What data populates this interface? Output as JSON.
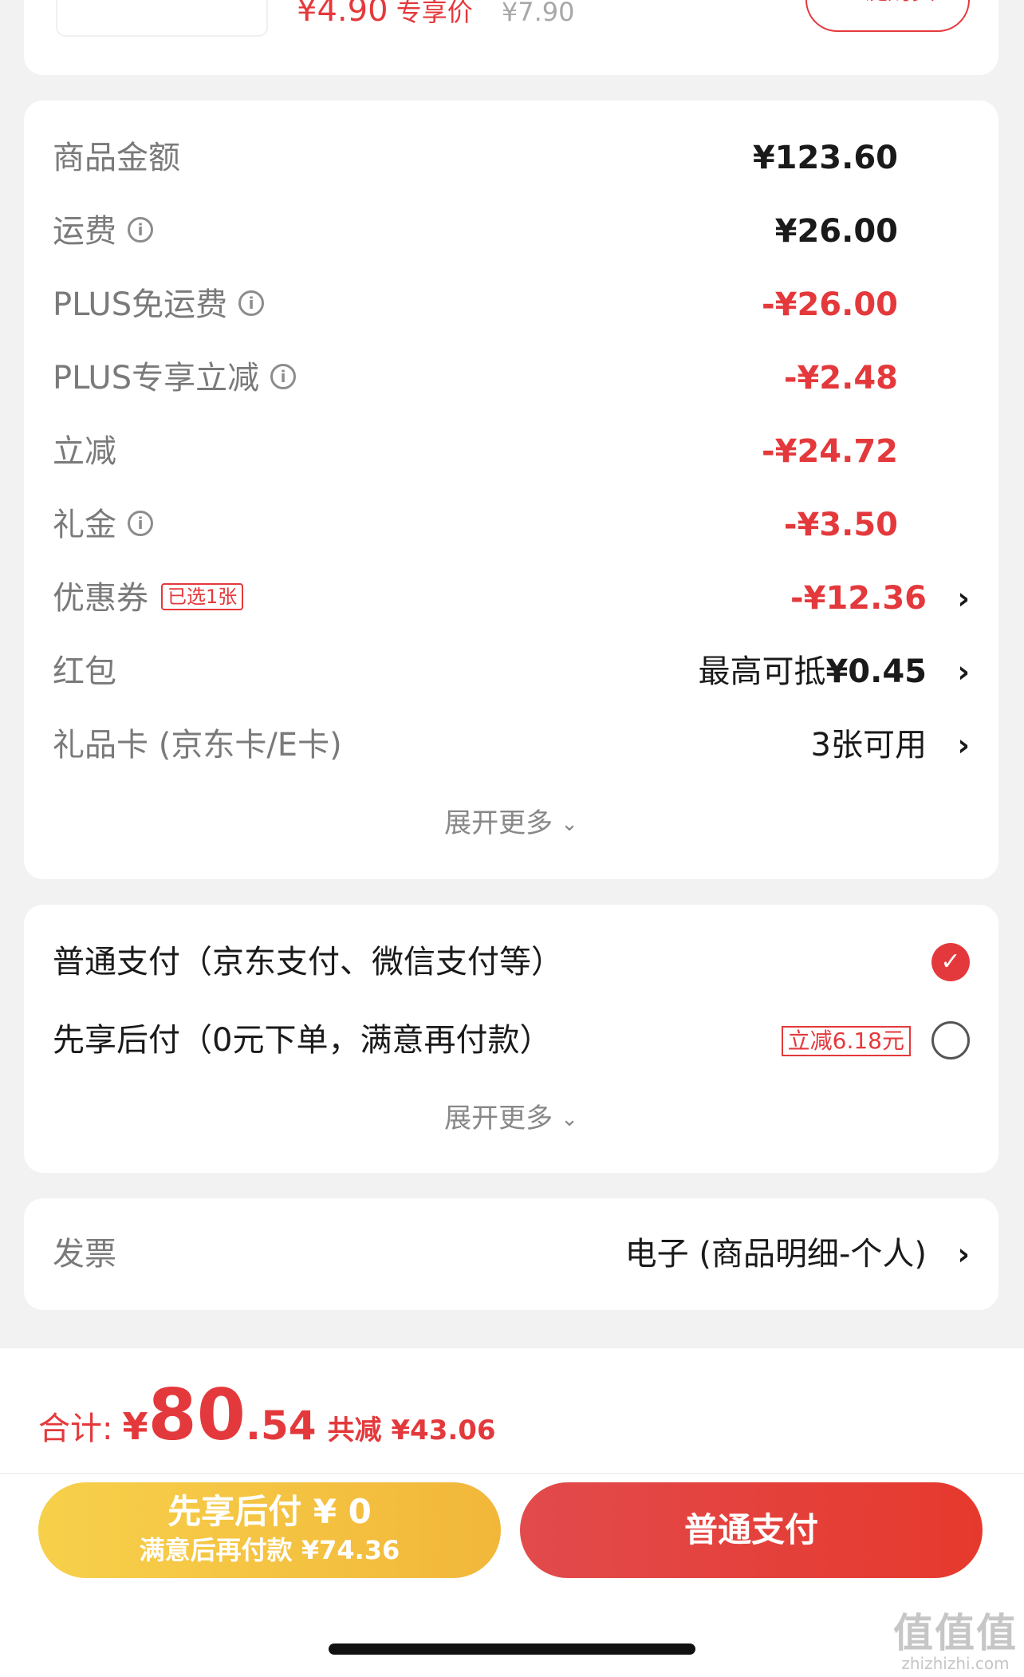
{
  "top_product": {
    "price": "¥4.90",
    "price_tag": "专享价",
    "original_price": "¥7.90",
    "quick_buy": "一键购买"
  },
  "summary": {
    "rows": [
      {
        "label": "商品金额",
        "value": "¥123.60",
        "info": false
      },
      {
        "label": "运费",
        "value": "¥26.00",
        "info": true
      },
      {
        "label": "PLUS免运费",
        "value": "-¥26.00",
        "info": true
      },
      {
        "label": "PLUS专享立减",
        "value": "-¥2.48",
        "info": true
      },
      {
        "label": "立减",
        "value": "-¥24.72",
        "info": false
      },
      {
        "label": "礼金",
        "value": "-¥3.50",
        "info": true
      }
    ],
    "coupon": {
      "label": "优惠券",
      "badge": "已选1张",
      "value": "-¥12.36"
    },
    "red_packet": {
      "label": "红包",
      "prefix": "最高可抵",
      "value": "¥0.45"
    },
    "gift_card": {
      "label": "礼品卡 (京东卡/E卡)",
      "value": "3张可用"
    },
    "expand_more": "展开更多"
  },
  "payment": {
    "options": [
      {
        "label": "普通支付（京东支付、微信支付等）",
        "selected": true
      },
      {
        "label": "先享后付（0元下单，满意再付款）",
        "selected": false,
        "tag": "立减6.18元"
      }
    ],
    "expand_more": "展开更多"
  },
  "invoice": {
    "label": "发票",
    "value": "电子 (商品明细-个人)"
  },
  "bottom_bar": {
    "total_label": "合计:",
    "currency": "¥",
    "total_int": "80",
    "total_dec": ".54",
    "saved": "共减 ¥43.06",
    "pay_later_line1": "先享后付 ¥ 0",
    "pay_later_line2": "满意后再付款 ¥74.36",
    "pay_now": "普通支付"
  },
  "watermark": {
    "line1": "值值值",
    "line2": "zhizhizhi.com"
  },
  "icons": {
    "info": "info-circle-icon",
    "chevron": "chevron-right-icon",
    "check": "checkmark-icon"
  },
  "colors": {
    "accent_red": "#e4393c",
    "pay_later_yellow": "#f4c440",
    "grey_label": "#7a7a7a"
  }
}
